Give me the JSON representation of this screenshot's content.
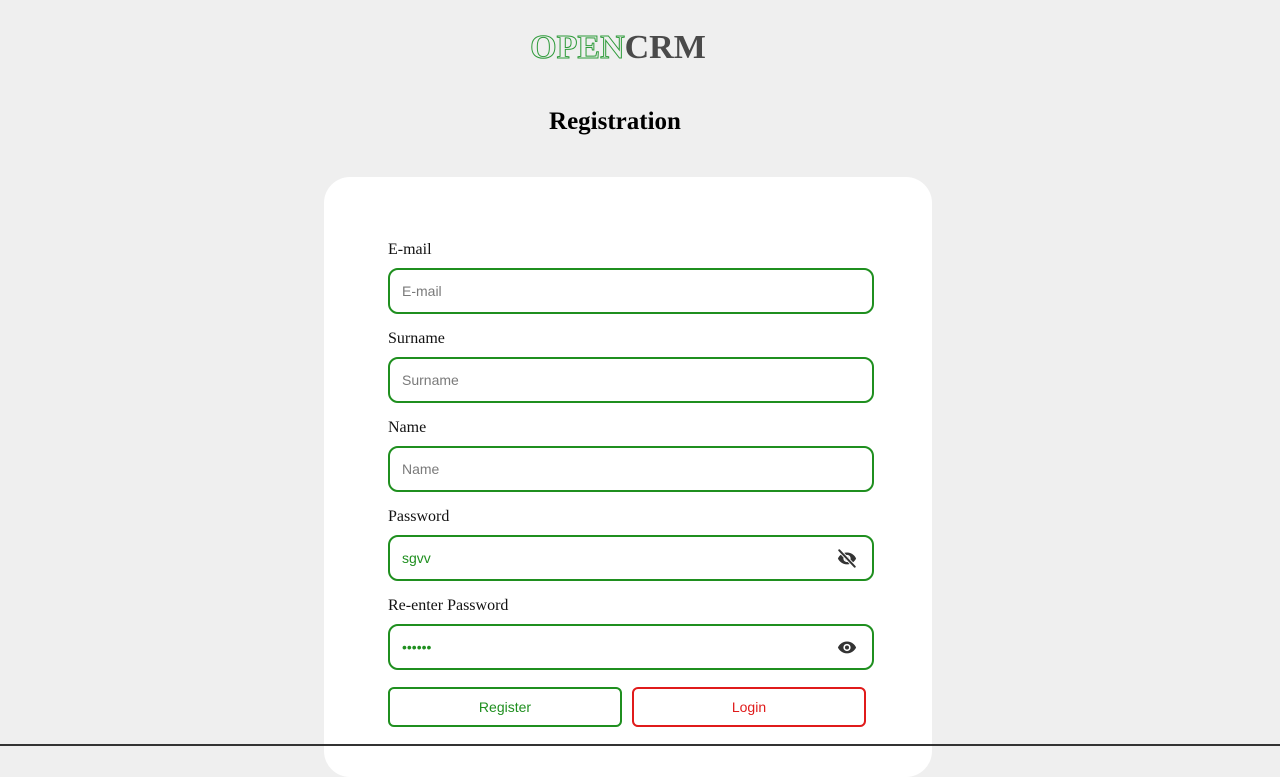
{
  "logo": {
    "part1": "OPEN",
    "part2": "CRM",
    "accent_color": "#2e9b3a",
    "text_color": "#4a4a4a"
  },
  "page_title": "Registration",
  "form": {
    "email": {
      "label": "E-mail",
      "placeholder": "E-mail",
      "value": ""
    },
    "surname": {
      "label": "Surname",
      "placeholder": "Surname",
      "value": ""
    },
    "name": {
      "label": "Name",
      "placeholder": "Name",
      "value": ""
    },
    "password": {
      "label": "Password",
      "value": "sgvv",
      "visible": true,
      "toggle_icon": "eye-slash-icon"
    },
    "reenter_password": {
      "label": "Re-enter Password",
      "value": "••••••",
      "visible": false,
      "toggle_icon": "eye-icon"
    }
  },
  "buttons": {
    "register": "Register",
    "login": "Login"
  },
  "colors": {
    "background": "#efefef",
    "field_border": "#1f8f1f",
    "register": "#1f8f1f",
    "login": "#e01b1b"
  }
}
